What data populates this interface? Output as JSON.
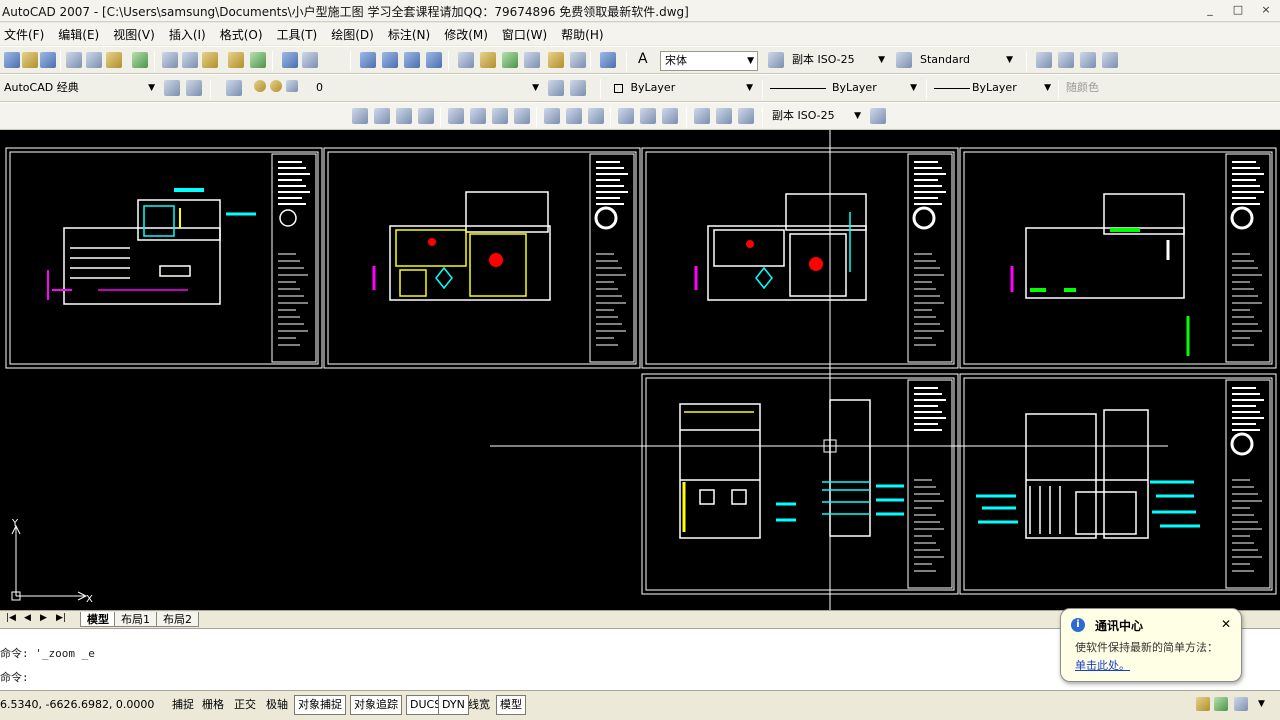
{
  "window": {
    "title": "AutoCAD 2007 - [C:\\Users\\samsung\\Documents\\小户型施工图 学习全套课程请加QQ：79674896 免费领取最新软件.dwg]",
    "buttons": [
      "_",
      "□",
      "×"
    ]
  },
  "menu": [
    "文件(F)",
    "编辑(E)",
    "视图(V)",
    "插入(I)",
    "格式(O)",
    "工具(T)",
    "绘图(D)",
    "标注(N)",
    "修改(M)",
    "窗口(W)",
    "帮助(H)"
  ],
  "toolbar1": {
    "font_value": "宋体",
    "dim_label": "副本 ISO-25",
    "table_style": "Standard"
  },
  "toolbar2": {
    "workspace": "AutoCAD 经典",
    "layer": "0",
    "color": "ByLayer",
    "linetype": "ByLayer",
    "lineweight": "ByLayer",
    "plotstyle": "随颜色"
  },
  "toolbar3": {
    "dim_style": "副本 ISO-25"
  },
  "tabs": [
    "模型",
    "布局1",
    "布局2"
  ],
  "command": {
    "history": "命令: '_zoom _e",
    "prompt": "命令:"
  },
  "status": {
    "coords": "6.5340, -6626.6982, 0.0000",
    "toggles": [
      {
        "label": "捕捉",
        "on": false
      },
      {
        "label": "栅格",
        "on": false
      },
      {
        "label": "正交",
        "on": false
      },
      {
        "label": "极轴",
        "on": false
      },
      {
        "label": "对象捕捉",
        "on": true
      },
      {
        "label": "对象追踪",
        "on": true
      },
      {
        "label": "DUCS",
        "on": true
      },
      {
        "label": "DYN",
        "on": true
      },
      {
        "label": "线宽",
        "on": false
      },
      {
        "label": "模型",
        "on": true
      }
    ]
  },
  "notification": {
    "title": "通讯中心",
    "message": "使软件保持最新的简单方法：",
    "link": "单击此处。"
  },
  "colors": {
    "canvas": "#000000",
    "cyan": "#00ffff",
    "magenta": "#ff00ff",
    "yellow": "#ffff00",
    "red": "#ff0000",
    "green": "#00ff00"
  }
}
